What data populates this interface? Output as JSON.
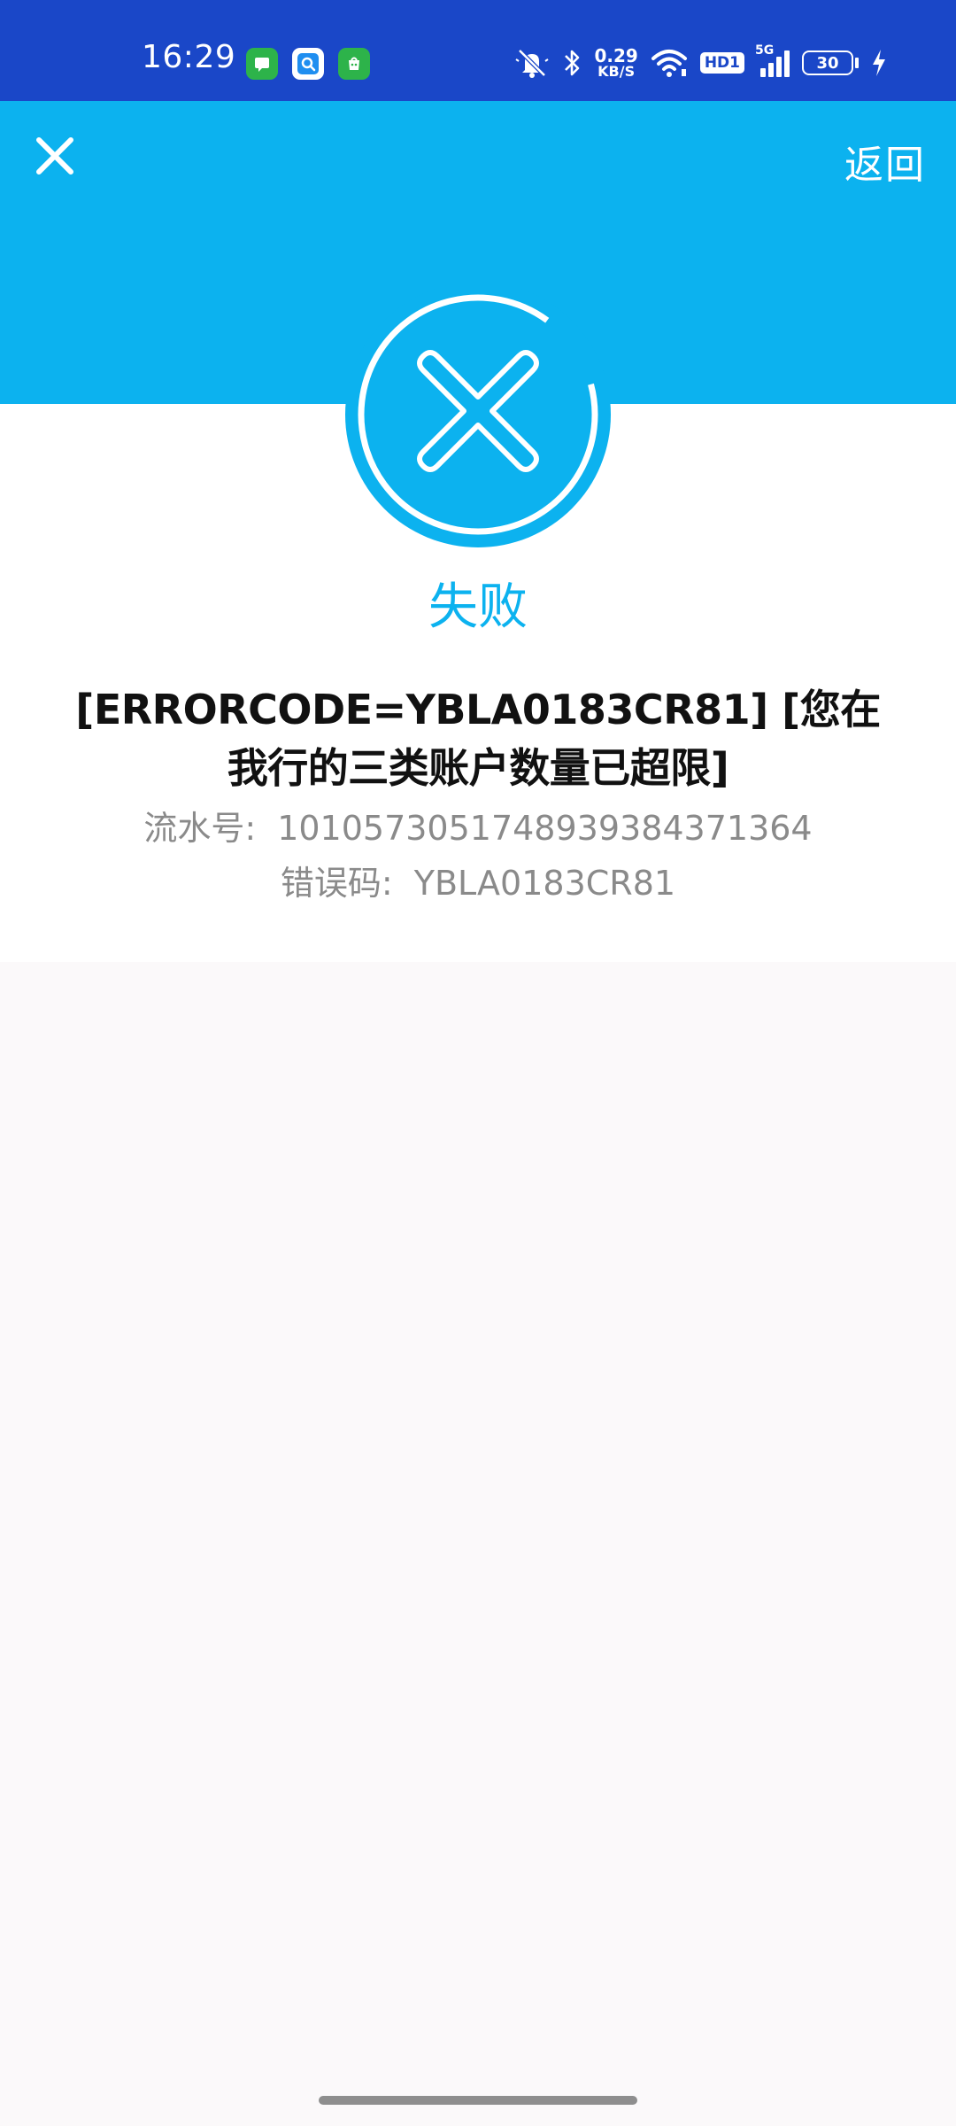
{
  "status_bar": {
    "time": "16:29",
    "network_speed_value": "0.29",
    "network_speed_unit": "KB/S",
    "hd_label": "HD1",
    "signal_label": "5G",
    "battery_level": "30",
    "app_icons": [
      "messages-icon",
      "search-app-icon",
      "store-app-icon"
    ]
  },
  "header": {
    "close_icon": "close-icon",
    "back_label": "返回"
  },
  "result": {
    "icon": "failure-x-icon",
    "title": "失败",
    "error_message": "[ERRORCODE=YBLA0183CR81] [您在我行的三类账户数量已超限]",
    "serial_label": "流水号:",
    "serial_value": "1010573051748939384371364",
    "error_code_label": "错误码:",
    "error_code_value": "YBLA0183CR81"
  },
  "colors": {
    "status_bar": "#1a47c8",
    "header": "#0cb2ef",
    "accent": "#0cb2ef",
    "detail_text": "#8a8a8a",
    "background": "#fbf9fa"
  }
}
